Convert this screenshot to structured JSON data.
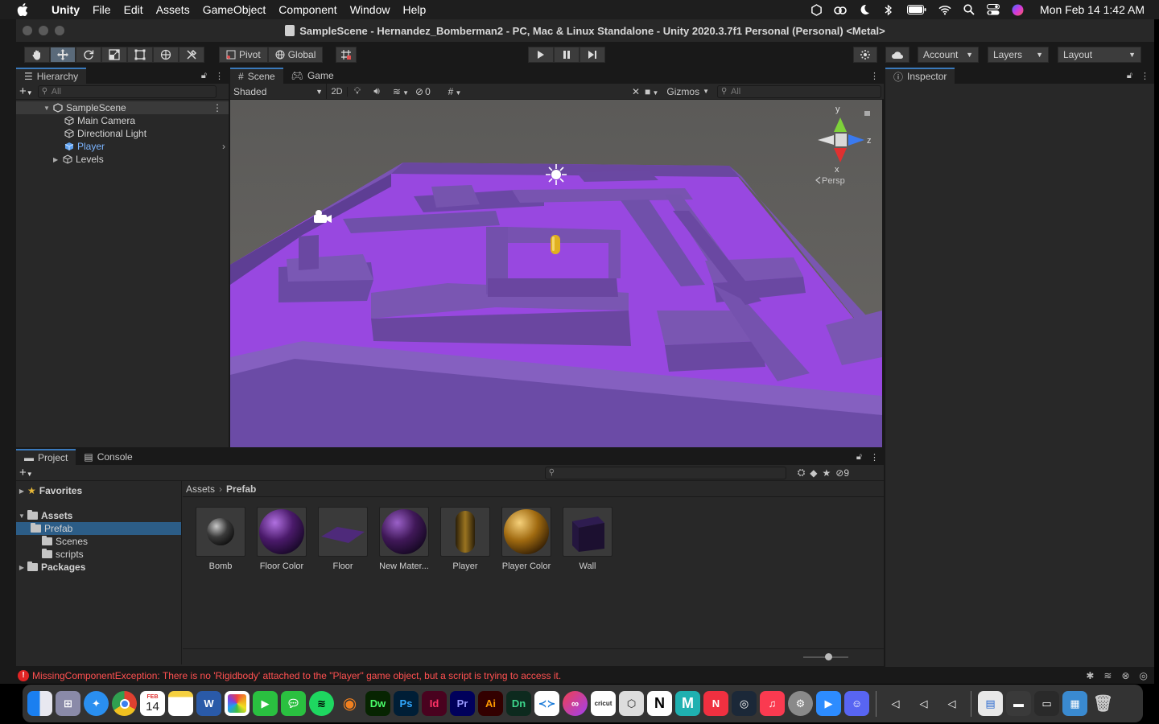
{
  "menubar": {
    "app_name": "Unity",
    "items": [
      "File",
      "Edit",
      "Assets",
      "GameObject",
      "Component",
      "Window",
      "Help"
    ],
    "clock": "Mon Feb 14  1:42 AM"
  },
  "window": {
    "title": "SampleScene - Hernandez_Bomberman2 - PC, Mac & Linux Standalone - Unity 2020.3.7f1 Personal (Personal) <Metal>"
  },
  "toolbar": {
    "pivot_label": "Pivot",
    "global_label": "Global",
    "account_label": "Account",
    "layers_label": "Layers",
    "layout_label": "Layout"
  },
  "hierarchy": {
    "tab_label": "Hierarchy",
    "search_placeholder": "All",
    "scene_name": "SampleScene",
    "items": [
      {
        "label": "Main Camera"
      },
      {
        "label": "Directional Light"
      },
      {
        "label": "Player"
      },
      {
        "label": "Levels"
      }
    ]
  },
  "scene": {
    "tab_scene": "Scene",
    "tab_game": "Game",
    "shading_mode": "Shaded",
    "mode_2d": "2D",
    "hidden_count": "0",
    "gizmos_label": "Gizmos",
    "search_placeholder": "All",
    "axis_y": "y",
    "axis_z": "z",
    "axis_x": "x",
    "projection": "Persp"
  },
  "inspector": {
    "tab_label": "Inspector"
  },
  "project": {
    "tab_project": "Project",
    "tab_console": "Console",
    "hidden_count": "9",
    "tree": {
      "favorites": "Favorites",
      "assets": "Assets",
      "prefab": "Prefab",
      "scenes": "Scenes",
      "scripts": "scripts",
      "packages": "Packages"
    },
    "breadcrumb": [
      "Assets",
      "Prefab"
    ],
    "assets": [
      {
        "name": "Bomb",
        "kind": "sphere",
        "color": "#3a3a3a"
      },
      {
        "name": "Floor Color",
        "kind": "sphere",
        "color": "#5a1f7a"
      },
      {
        "name": "Floor",
        "kind": "plane",
        "color": "#4e2a7a"
      },
      {
        "name": "New Mater...",
        "kind": "sphere",
        "color": "#4a1e66"
      },
      {
        "name": "Player",
        "kind": "capsule",
        "color": "#8a6a1a"
      },
      {
        "name": "Player Color",
        "kind": "sphere",
        "color": "#b07a18"
      },
      {
        "name": "Wall",
        "kind": "cube",
        "color": "#2a1a48"
      }
    ]
  },
  "status": {
    "error_message": "MissingComponentException: There is no 'Rigidbody' attached to the \"Player\" game object, but a script is trying to access it."
  },
  "colors": {
    "accent": "#3a79bb",
    "floor": "#9a4ee0",
    "wall": "#7a52b0",
    "player": "#e0b020"
  },
  "dock": {
    "calendar_month": "FEB",
    "calendar_day": "14",
    "apps": [
      "finder",
      "launchpad",
      "safari",
      "chrome",
      "calendar",
      "notes",
      "word",
      "photos",
      "facetime",
      "messages",
      "spotify",
      "blender",
      "dreamweaver",
      "photoshop",
      "indesign",
      "premiere",
      "illustrator",
      "dimension",
      "vscode",
      "creative-cloud",
      "cricut",
      "unity-hub",
      "notion",
      "maya",
      "news",
      "steam",
      "music",
      "settings",
      "zoom",
      "discord",
      "unity",
      "unity",
      "unity",
      "preview",
      "finder-window",
      "app-window",
      "app-window-2",
      "trash"
    ]
  }
}
